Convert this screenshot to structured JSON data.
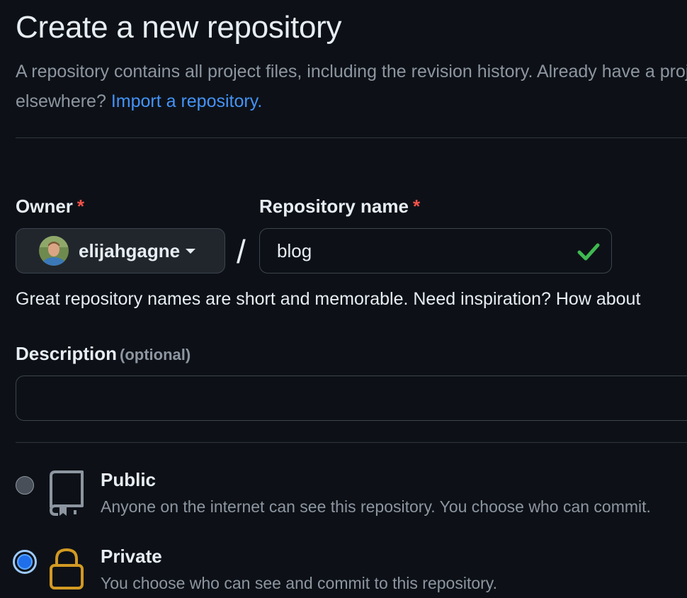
{
  "page": {
    "title": "Create a new repository",
    "subtitle_line1": "A repository contains all project files, including the revision history. Already have a project repository",
    "subtitle_line2": "elsewhere?",
    "import_link": "Import a repository."
  },
  "owner": {
    "label": "Owner",
    "required_mark": "*",
    "value": "elijahgagne"
  },
  "repo_name": {
    "label": "Repository name",
    "required_mark": "*",
    "value": "blog",
    "separator": "/"
  },
  "hint": "Great repository names are short and memorable. Need inspiration? How about",
  "description": {
    "label": "Description",
    "optional": "(optional)",
    "value": ""
  },
  "visibility": {
    "public": {
      "title": "Public",
      "desc": "Anyone on the internet can see this repository. You choose who can commit.",
      "selected": false
    },
    "private": {
      "title": "Private",
      "desc": "You choose who can see and commit to this repository.",
      "selected": true
    }
  },
  "icons": {
    "valid": "check-icon",
    "public": "repo-book-icon",
    "private": "lock-icon",
    "dropdown": "caret-down-icon"
  },
  "colors": {
    "background": "#0d1117",
    "link": "#4493f8",
    "required": "#f85149",
    "success": "#3fb950",
    "lock": "#d29922",
    "radio_selected": "#1f6feb"
  }
}
